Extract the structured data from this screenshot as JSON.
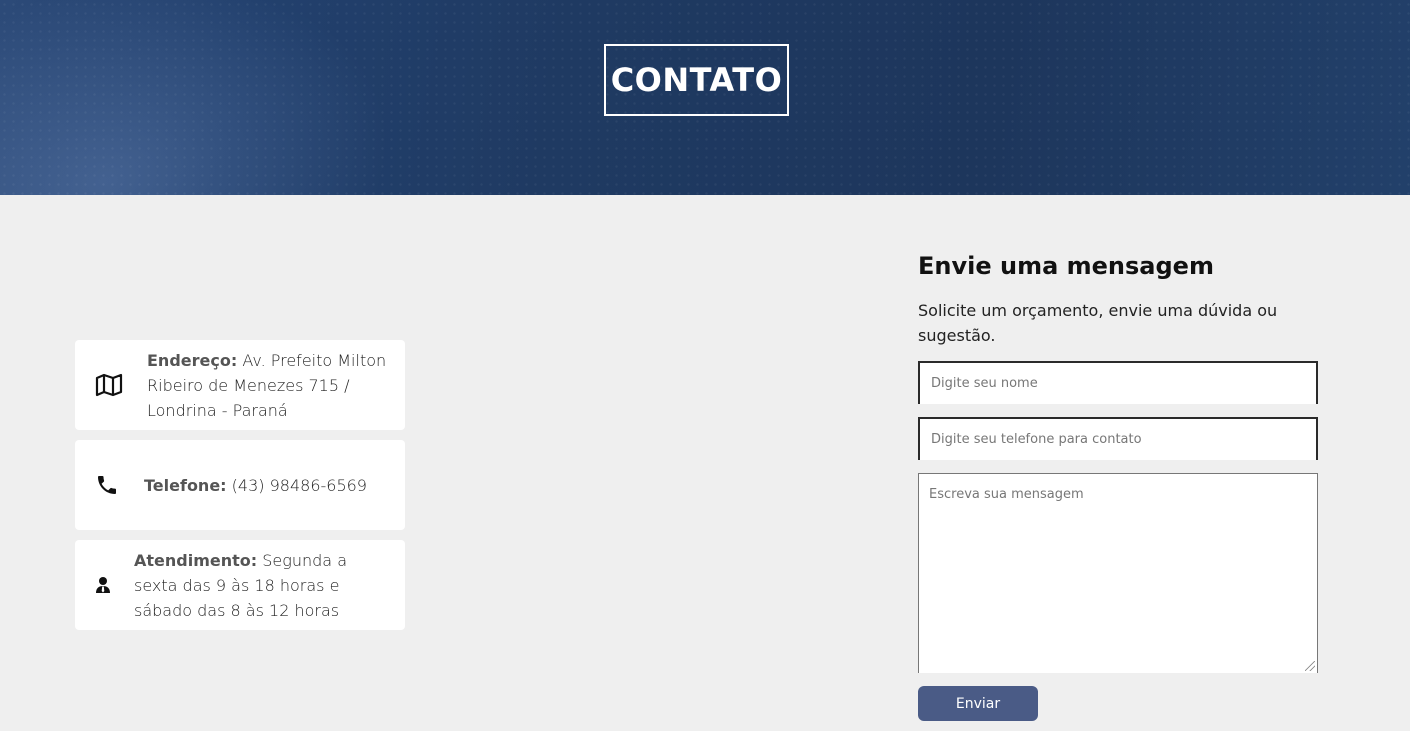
{
  "hero": {
    "title": "CONTATO"
  },
  "info_cards": [
    {
      "icon": "map-icon",
      "label": "Endereço:",
      "value": " Av. Prefeito Milton Ribeiro de Menezes 715 / Londrina - Paraná"
    },
    {
      "icon": "phone-icon",
      "label": "Telefone:",
      "value": " (43) 98486-6569"
    },
    {
      "icon": "user-tie-icon",
      "label": "Atendimento:",
      "value": " Segunda a sexta das 9 às 18 horas e sábado das 8 às 12 horas"
    }
  ],
  "form": {
    "title": "Envie uma mensagem",
    "subtitle": "Solicite um orçamento, envie uma dúvida ou sugestão.",
    "name_placeholder": "Digite seu nome",
    "phone_placeholder": "Digite seu telefone para contato",
    "message_placeholder": "Escreva sua mensagem",
    "submit_label": "Enviar"
  },
  "colors": {
    "hero_bg": "#1f3a62",
    "page_bg": "#efefef",
    "button_bg": "#4a5b86"
  }
}
